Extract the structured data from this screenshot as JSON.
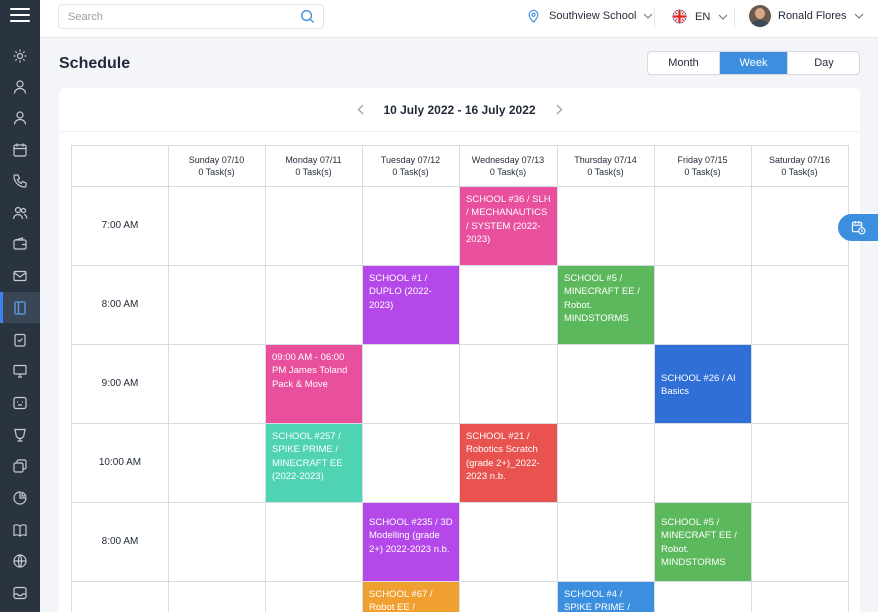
{
  "search": {
    "placeholder": "Search"
  },
  "header": {
    "school": "Southview School",
    "language": "EN",
    "user_name": "Ronald Flores"
  },
  "page": {
    "title": "Schedule"
  },
  "view_toggle": {
    "options": [
      "Month",
      "Week",
      "Day"
    ],
    "selected": "Week"
  },
  "week": {
    "range_label": "10 July 2022 - 16 July 2022"
  },
  "days": [
    {
      "name": "Sunday 07/10",
      "tasks": "0 Task(s)"
    },
    {
      "name": "Monday 07/11",
      "tasks": "0 Task(s)"
    },
    {
      "name": "Tuesday 07/12",
      "tasks": "0 Task(s)"
    },
    {
      "name": "Wednesday 07/13",
      "tasks": "0 Task(s)"
    },
    {
      "name": "Thursday 07/14",
      "tasks": "0 Task(s)"
    },
    {
      "name": "Friday 07/15",
      "tasks": "0 Task(s)"
    },
    {
      "name": "Saturday 07/16",
      "tasks": "0 Task(s)"
    }
  ],
  "times": [
    "7:00 AM",
    "8:00 AM",
    "9:00 AM",
    "10:00 AM",
    "8:00 AM"
  ],
  "events": [
    {
      "text": "SCHOOL #36 / SLH / MECHANAUTICS / SYSTEM (2022-2023)",
      "color": "#e84f9c"
    },
    {
      "text": "SCHOOL #1 / DUPLO (2022-2023)",
      "color": "#b548e8"
    },
    {
      "text": "SCHOOL #5 / MINECRAFT EE / Robot. MINDSTORMS",
      "color": "#5cb85c"
    },
    {
      "text": "09:00 AM - 06:00 PM James Toland Pack & Move",
      "color": "#e84f9c"
    },
    {
      "text": "SCHOOL #26 / AI Basics",
      "color": "#2f6fd6"
    },
    {
      "text": "SCHOOL #257 / SPIKE PRIME / MINECRAFT EE (2022-2023)",
      "color": "#4fd3b2"
    },
    {
      "text": "SCHOOL #21 / Robotics Scratch (grade 2+)_2022-2023 n.b.",
      "color": "#e9534f"
    },
    {
      "text": "SCHOOL #235 / 3D Modelling (grade 2+) 2022-2023 n.b.",
      "color": "#b548e8"
    },
    {
      "text": "SCHOOL #5 / MINECRAFT EE / Robot. MINDSTORMS",
      "color": "#5cb85c"
    },
    {
      "text": "SCHOOL #67 / Robot EE /",
      "color": "#f0a030"
    },
    {
      "text": "SCHOOL #4 / SPIKE PRIME /",
      "color": "#3b8fde"
    }
  ],
  "icons": {
    "sidebar": [
      "gear-icon",
      "user-icon",
      "user-alt-icon",
      "calendar-icon",
      "phone-icon",
      "users-icon",
      "wallet-icon",
      "mail-icon",
      "schedule-icon",
      "clipboard-icon",
      "monitor-icon",
      "chat-icon",
      "trophy-icon",
      "cards-icon",
      "chart-pie-icon",
      "book-icon",
      "globe-icon",
      "inbox-icon"
    ],
    "active_sidebar": "schedule-icon"
  },
  "colors": {
    "accent": "#3b8fde",
    "sidebar_bg": "#2a3441"
  }
}
